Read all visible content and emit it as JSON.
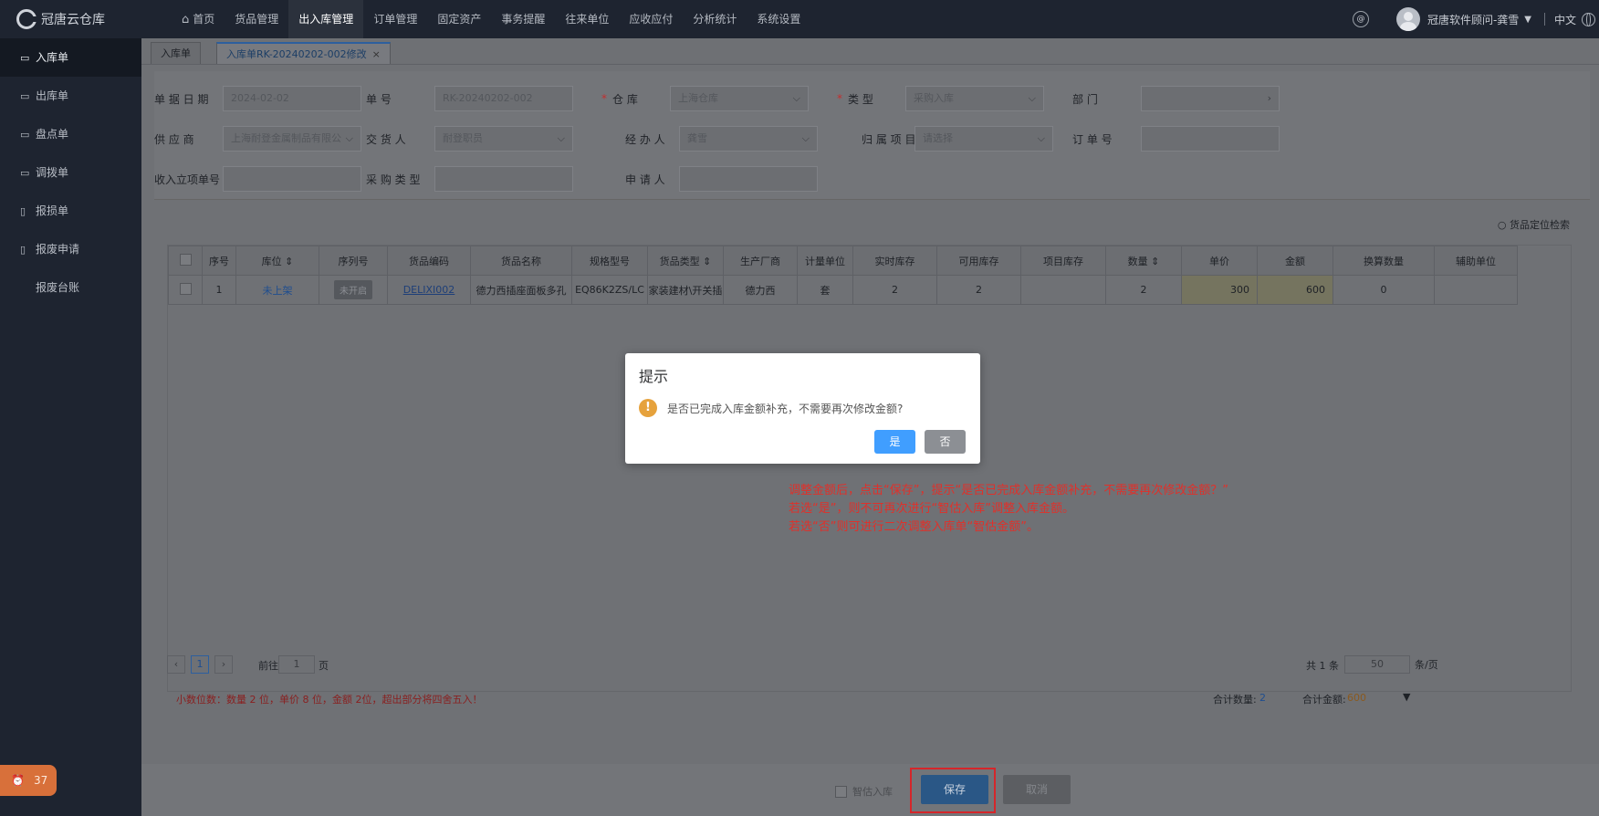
{
  "app": {
    "name": "冠唐云仓库"
  },
  "nav": {
    "items": [
      "首页",
      "货品管理",
      "出入库管理",
      "订单管理",
      "固定资产",
      "事务提醒",
      "往来单位",
      "应收应付",
      "分析统计",
      "系统设置"
    ],
    "active": "出入库管理"
  },
  "header": {
    "user": "冠唐软件顾问-龚雪",
    "lang": "中文"
  },
  "sidebar": {
    "items": [
      "入库单",
      "出库单",
      "盘点单",
      "调拨单",
      "报损单",
      "报废申请",
      "报废台账"
    ],
    "badge": "37"
  },
  "tabs": [
    {
      "label": "入库单"
    },
    {
      "label": "入库单RK-20240202-002修改"
    }
  ],
  "form": {
    "date_label": "单 据 日 期",
    "date_value": "2024-02-02",
    "no_label": "单          号",
    "no_value": "RK-20240202-002",
    "warehouse_label": "仓          库",
    "warehouse_value": "上海仓库",
    "type_label": "类          型",
    "type_value": "采购入库",
    "dept_label": "部          门",
    "dept_value": "",
    "supplier_label": "供   应   商",
    "supplier_value": "上海耐登金属制品有限公",
    "deliverer_label": "交   货   人",
    "deliverer_value": "耐登职员",
    "handler_label": "经   办   人",
    "handler_value": "龚雪",
    "project_label": "归 属 项 目",
    "project_placeholder": "请选择",
    "order_label": "订   单   号",
    "order_value": "",
    "income_label": "收入立项单号",
    "income_value": "",
    "purchase_type_label": "采 购 类 型",
    "purchase_type_value": "",
    "applicant_label": "申   请   人",
    "applicant_value": ""
  },
  "table": {
    "locate_label": "货品定位检索",
    "headers": [
      "序号",
      "库位",
      "序列号",
      "货品编码",
      "货品名称",
      "规格型号",
      "货品类型",
      "生产厂商",
      "计量单位",
      "实时库存",
      "可用库存",
      "项目库存",
      "数量",
      "单价",
      "金额",
      "换算数量",
      "辅助单位"
    ],
    "row": {
      "no": "1",
      "location": "未上架",
      "serial": "未开启",
      "code": "DELIXI002",
      "name": "德力西插座面板多孔",
      "spec": "EQ86K2ZS/LC",
      "category": "家装建材\\开关插",
      "maker": "德力西",
      "unit": "套",
      "stock": "2",
      "available": "2",
      "project_stock": "",
      "qty": "2",
      "price": "300",
      "amount": "600",
      "conv_qty": "0",
      "aux_unit": ""
    }
  },
  "pager": {
    "current": "1",
    "goto_label": "前往",
    "goto_value": "1",
    "page_suffix": "页",
    "total": "共 1 条",
    "page_size": "50",
    "per_page": "条/页"
  },
  "summary": {
    "decimal_note": "小数位数：数量 2 位，单价 8 位，金额 2位，超出部分将四舍五入！",
    "total_qty_label": "合计数量:",
    "total_qty": "2",
    "total_amount_label": "合计金额:",
    "total_amount": "600"
  },
  "footer": {
    "smart_label": "智估入库",
    "save": "保存",
    "cancel": "取消"
  },
  "dialog": {
    "title": "提示",
    "message": "是否已完成入库金额补充，不需要再次修改金额?",
    "yes": "是",
    "no": "否"
  },
  "annotation": {
    "line1": "调整金额后，点击“保存”，提示“是否已完成入库金额补充，不需要再次修改金额？”",
    "line2": "若选“是”，则不可再次进行“智估入库”调整入库金额。",
    "line3": "若选“否”则可进行二次调整入库单“智估金额”。"
  }
}
